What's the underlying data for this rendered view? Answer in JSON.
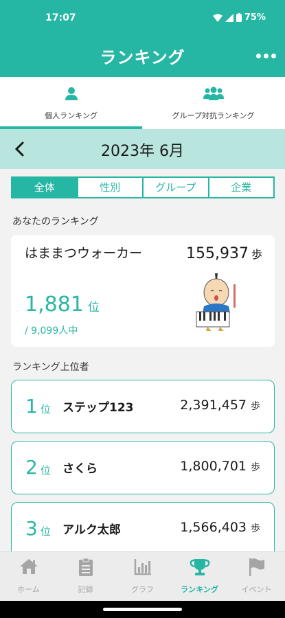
{
  "status": {
    "time": "17:07",
    "battery": "75%"
  },
  "app": {
    "title": "ランキング"
  },
  "tabs": [
    {
      "label": "個人ランキング",
      "icon": "person-icon"
    },
    {
      "label": "グループ対抗ランキング",
      "icon": "group-icon"
    }
  ],
  "month": {
    "label": "2023年 6月"
  },
  "filters": [
    "全体",
    "性別",
    "グループ",
    "企業"
  ],
  "my_ranking": {
    "section_title": "あなたのランキング",
    "name": "はままつウォーカー",
    "steps": "155,937",
    "steps_unit": "歩",
    "rank": "1,881",
    "rank_unit": "位",
    "total": "/ 9,099人中"
  },
  "top_section_title": "ランキング上位者",
  "top_rankers": [
    {
      "rank": "1",
      "rank_unit": "位",
      "name": "ステップ123",
      "steps": "2,391,457",
      "steps_unit": "歩"
    },
    {
      "rank": "2",
      "rank_unit": "位",
      "name": "さくら",
      "steps": "1,800,701",
      "steps_unit": "歩"
    },
    {
      "rank": "3",
      "rank_unit": "位",
      "name": "アルク太郎",
      "steps": "1,566,403",
      "steps_unit": "歩"
    }
  ],
  "bottom_nav": [
    {
      "label": "ホーム",
      "icon": "home-icon"
    },
    {
      "label": "記録",
      "icon": "clipboard-icon"
    },
    {
      "label": "グラフ",
      "icon": "bar-chart-icon"
    },
    {
      "label": "ランキング",
      "icon": "trophy-icon",
      "active": true
    },
    {
      "label": "イベント",
      "icon": "flag-icon"
    }
  ],
  "colors": {
    "accent": "#26b6a4",
    "month_bar": "#b9e5df",
    "inactive": "#a5a5a5"
  }
}
